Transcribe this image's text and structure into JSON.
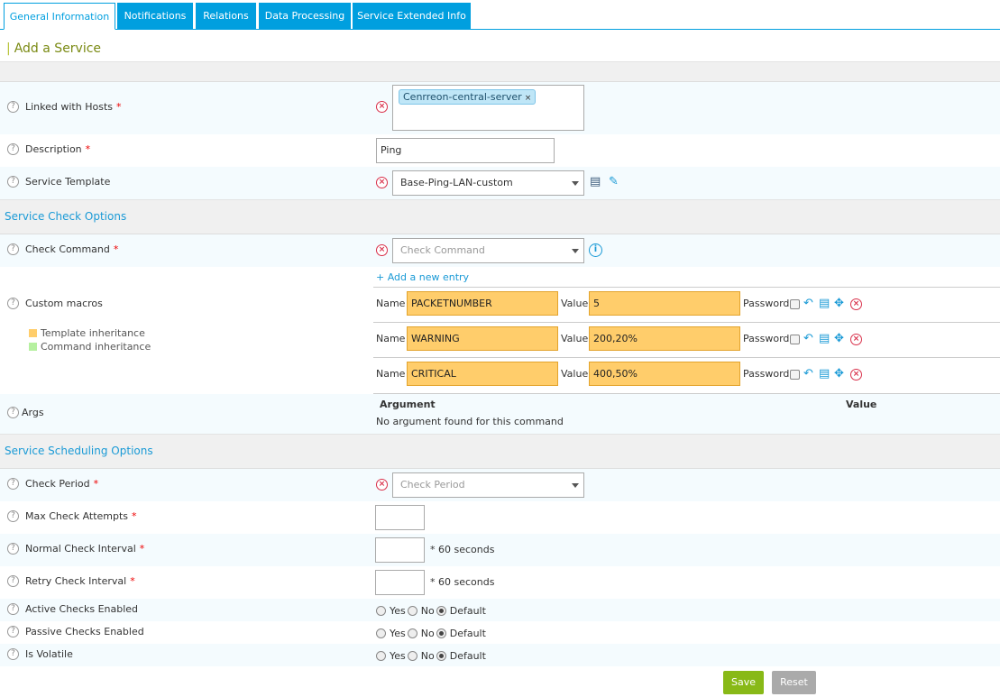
{
  "tabs": [
    "General Information",
    "Notifications",
    "Relations",
    "Data Processing",
    "Service Extended Info"
  ],
  "page_title": "Add a Service",
  "fields": {
    "linked_hosts": {
      "label": "Linked with Hosts",
      "tag": "Cenrreon-central-server"
    },
    "description": {
      "label": "Description",
      "value": "Ping"
    },
    "service_template": {
      "label": "Service Template",
      "value": "Base-Ping-LAN-custom"
    }
  },
  "sections": {
    "check_options": "Service Check Options",
    "scheduling_options": "Service Scheduling Options"
  },
  "check_command": {
    "label": "Check Command",
    "placeholder": "Check Command"
  },
  "custom_macros": {
    "label": "Custom macros",
    "add_entry": "+ Add a new entry",
    "name_label": "Name",
    "value_label": "Value",
    "password_label": "Password",
    "legend": {
      "template": "Template inheritance",
      "command": "Command inheritance"
    },
    "rows": [
      {
        "name": "PACKETNUMBER",
        "value": "5"
      },
      {
        "name": "WARNING",
        "value": "200,20%"
      },
      {
        "name": "CRITICAL",
        "value": "400,50%"
      }
    ]
  },
  "args": {
    "label": "Args",
    "col_argument": "Argument",
    "col_value": "Value",
    "empty": "No argument found for this command"
  },
  "scheduling": {
    "check_period": {
      "label": "Check Period",
      "placeholder": "Check Period"
    },
    "max_attempts": {
      "label": "Max Check Attempts"
    },
    "normal_interval": {
      "label": "Normal Check Interval",
      "unit": "* 60 seconds"
    },
    "retry_interval": {
      "label": "Retry Check Interval",
      "unit": "* 60 seconds"
    }
  },
  "radios": {
    "yes": "Yes",
    "no": "No",
    "default": "Default",
    "active": "Active Checks Enabled",
    "passive": "Passive Checks Enabled",
    "volatile": "Is Volatile"
  },
  "buttons": {
    "save": "Save",
    "reset": "Reset"
  },
  "colors": {
    "accent": "#009fdf",
    "save": "#88b917",
    "reset": "#aaaaaa",
    "template_inheritance": "#ffcd6b",
    "command_inheritance": "#b6f0a0"
  }
}
